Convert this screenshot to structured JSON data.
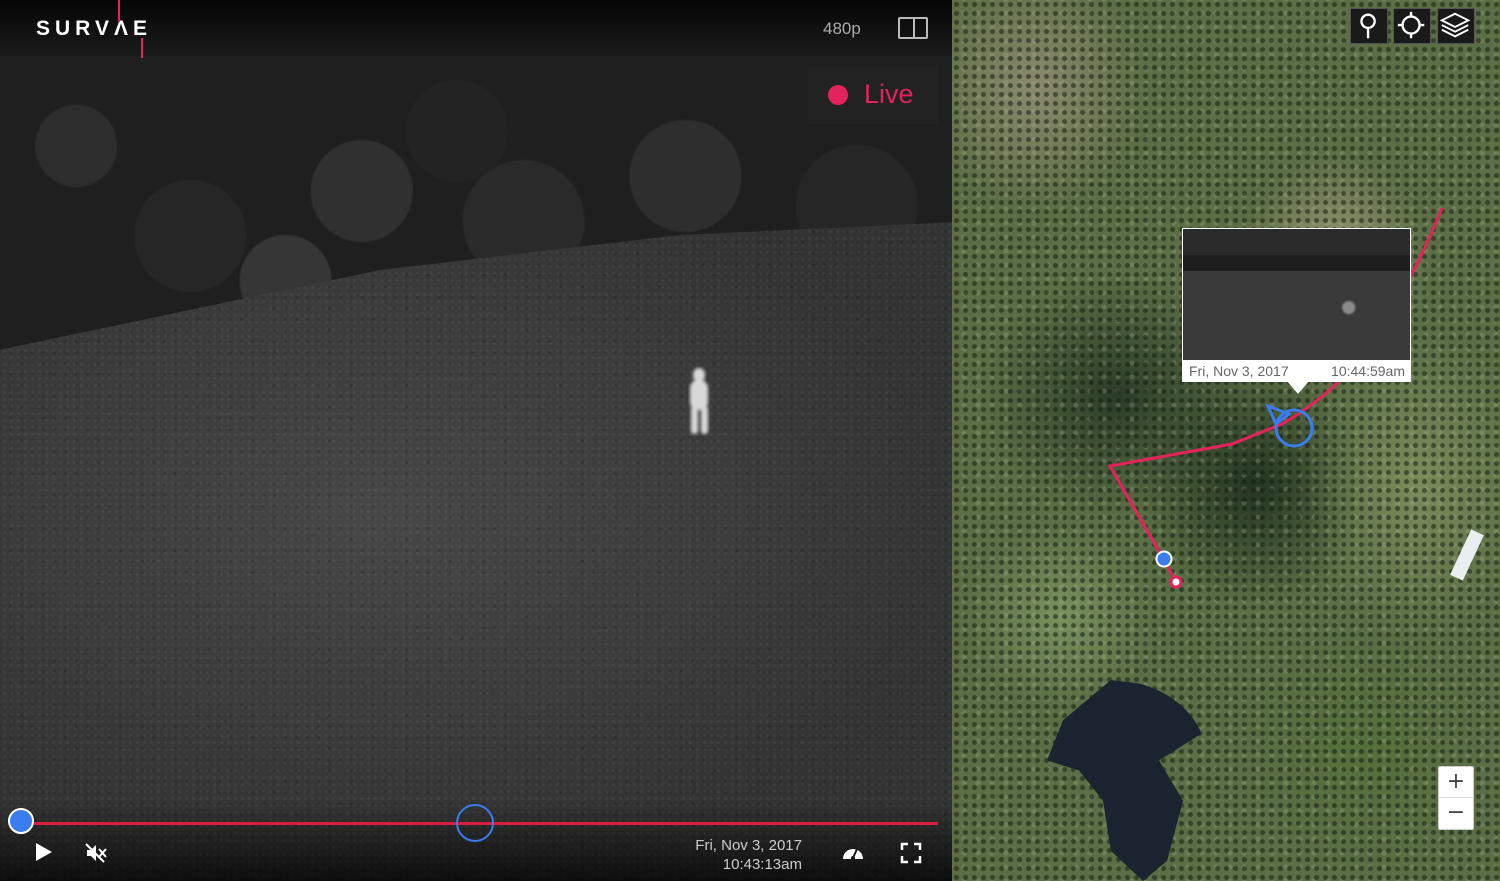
{
  "app": {
    "logo": "SURVΛE"
  },
  "video": {
    "quality": "480p",
    "live_label": "Live",
    "timestamp_date": "Fri, Nov 3, 2017",
    "timestamp_time": "10:43:13am",
    "playback_progress": 0.0
  },
  "map": {
    "popup": {
      "date": "Fri, Nov 3, 2017",
      "time": "10:44:59am"
    },
    "zoom_in_label": "+",
    "zoom_out_label": "−"
  },
  "colors": {
    "accent_red": "#e2245a",
    "track_red": "#d81f3e",
    "marker_blue": "#3b7cf0"
  },
  "icons": [
    "split-view-icon",
    "play-icon",
    "mute-icon",
    "speedometer-icon",
    "fullscreen-icon",
    "map-pin-icon",
    "crosshair-icon",
    "layers-icon"
  ]
}
